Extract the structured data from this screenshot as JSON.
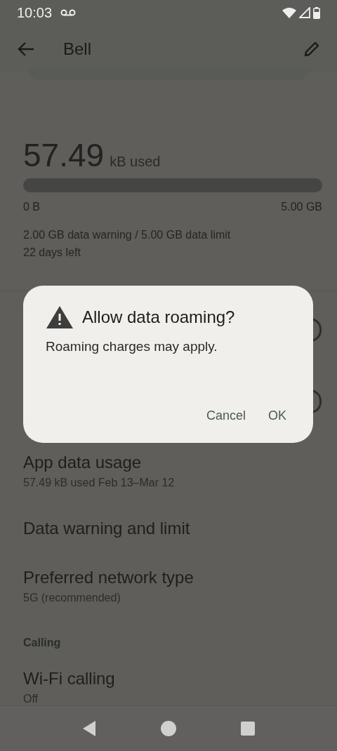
{
  "status_bar": {
    "time": "10:03"
  },
  "app_bar": {
    "title": "Bell"
  },
  "usage": {
    "amount": "57.49",
    "unit": "kB used",
    "level": 0,
    "min_label": "0 B",
    "max_label": "5.00 GB",
    "warning": "2.00 GB data warning / 5.00 GB data limit",
    "days_left": "22 days left"
  },
  "covered_switches": [
    {
      "on": false
    },
    {
      "on": false
    }
  ],
  "settings": [
    {
      "kind": "item",
      "title": "App data usage",
      "summary": "57.49 kB used Feb 13–Mar 12"
    },
    {
      "kind": "item",
      "title": "Data warning and limit"
    },
    {
      "kind": "item",
      "title": "Preferred network type",
      "summary": "5G (recommended)"
    },
    {
      "kind": "header",
      "title": "Calling"
    },
    {
      "kind": "item",
      "title": "Wi-Fi calling",
      "summary": "Off"
    }
  ],
  "dialog": {
    "title": "Allow data roaming?",
    "message": "Roaming charges may apply.",
    "buttons": [
      "Cancel",
      "OK"
    ]
  }
}
